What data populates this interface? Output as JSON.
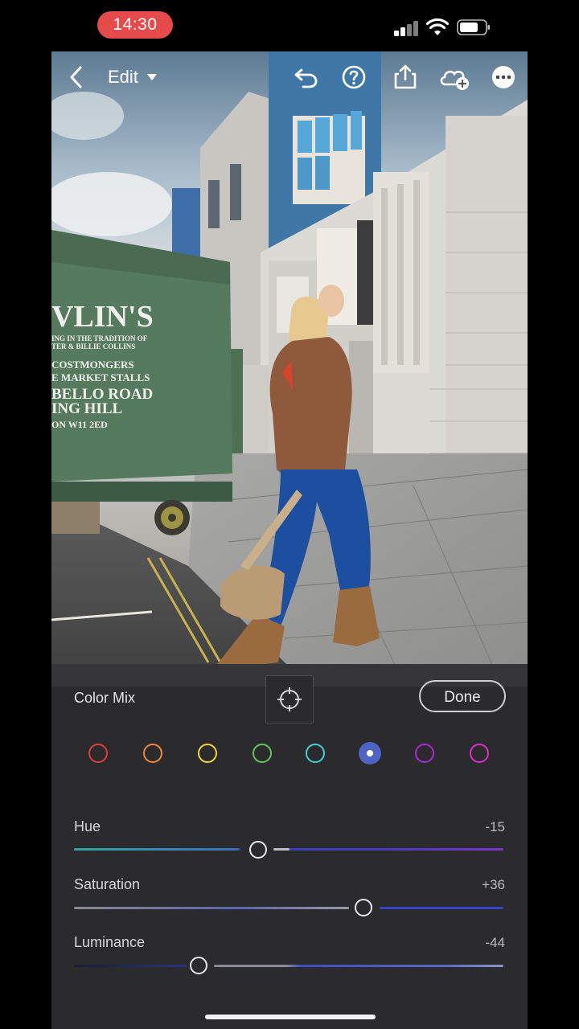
{
  "status": {
    "time": "14:30"
  },
  "toolbar": {
    "edit_label": "Edit"
  },
  "photo": {
    "sign": {
      "line1": "VLIN'S",
      "line2": "ING IN THE TRADITION OF",
      "line3": "TER & BILLIE COLLINS",
      "line4": "COSTMONGERS",
      "line5": "E MARKET STALLS",
      "line6": "BELLO ROAD",
      "line7": "ING HILL",
      "line8": "ON W11 2ED"
    }
  },
  "panel": {
    "title": "Color Mix",
    "done_label": "Done",
    "swatches": [
      {
        "name": "red",
        "color": "#e23b3b"
      },
      {
        "name": "orange",
        "color": "#f0883a"
      },
      {
        "name": "yellow",
        "color": "#f2d43b"
      },
      {
        "name": "green",
        "color": "#63c65a"
      },
      {
        "name": "aqua",
        "color": "#3fd2d6"
      },
      {
        "name": "blue",
        "color": "#4f63c4",
        "selected": true
      },
      {
        "name": "purple",
        "color": "#a62ad8"
      },
      {
        "name": "magenta",
        "color": "#d92fcf"
      }
    ],
    "sliders": [
      {
        "label": "Hue",
        "value": "-15",
        "level": -15
      },
      {
        "label": "Saturation",
        "value": "+36",
        "level": 36
      },
      {
        "label": "Luminance",
        "value": "-44",
        "level": -44
      }
    ]
  },
  "colors": {
    "panel_bg": "#2b2a2c",
    "accent_blue": "#4f63c4",
    "time_pill": "#e54b4b"
  }
}
